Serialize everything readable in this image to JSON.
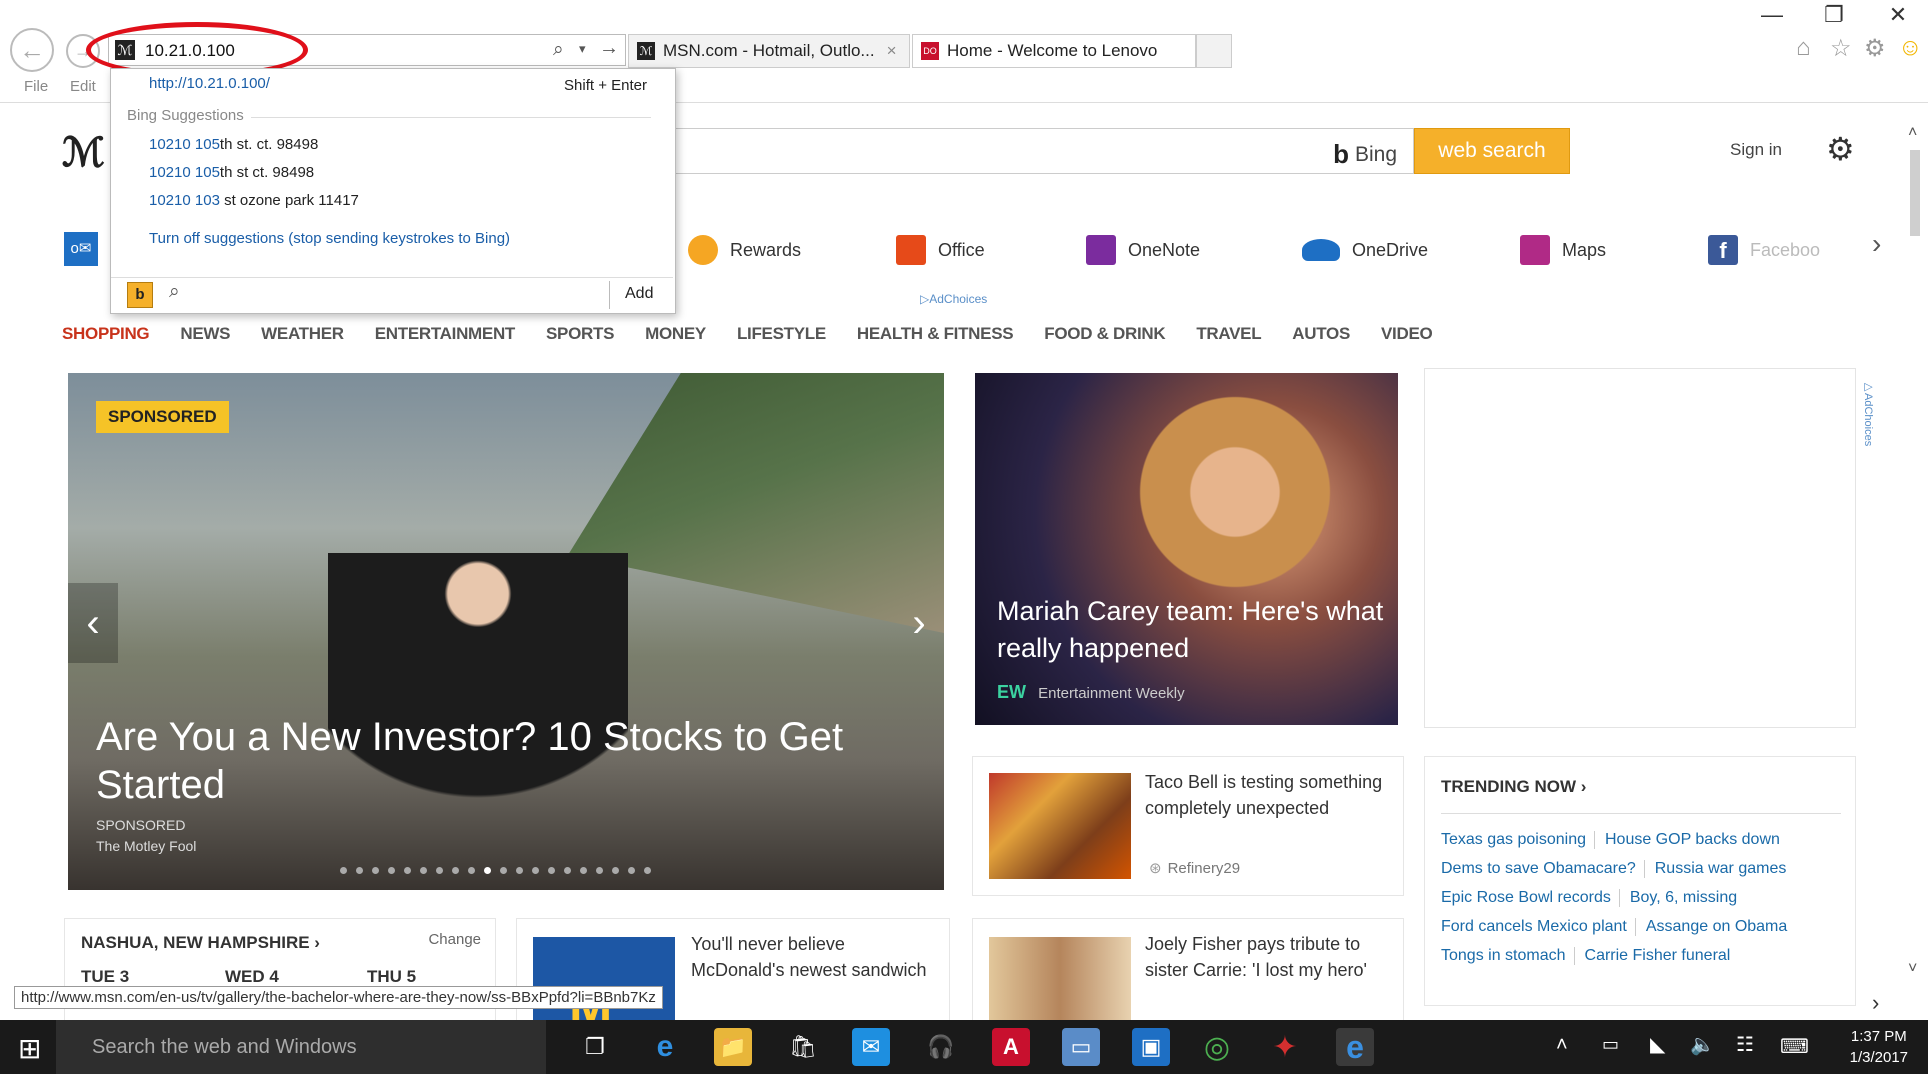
{
  "browser": {
    "address": "10.21.0.100",
    "tabs": [
      {
        "label": "MSN.com - Hotmail, Outlo...",
        "close": "×"
      },
      {
        "label": "Home - Welcome to Lenovo"
      }
    ],
    "menu": [
      "File",
      "Edit"
    ],
    "window_buttons": {
      "minimize": "—",
      "restore": "❐",
      "close": "✕"
    }
  },
  "dropdown": {
    "url_hint": "http://10.21.0.100/",
    "shortcut": "Shift + Enter",
    "section": "Bing Suggestions",
    "suggestions": [
      {
        "match": "10210 105",
        "rest": "th st. ct. 98498"
      },
      {
        "match": "10210 105",
        "rest": "th st ct. 98498"
      },
      {
        "match": "10210 103",
        "rest": " st ozone park 11417"
      }
    ],
    "turn_off": "Turn off suggestions (stop sending keystrokes to Bing)",
    "add": "Add"
  },
  "msn": {
    "bing_label": "Bing",
    "web_search": "web search",
    "sign_in": "Sign in",
    "adchoices": "AdChoices",
    "quicklinks": [
      {
        "label": "Rewards",
        "icon": "rewards-icon",
        "color": "#f5a623"
      },
      {
        "label": "Office",
        "icon": "office-icon",
        "color": "#e64a19"
      },
      {
        "label": "OneNote",
        "icon": "onenote-icon",
        "color": "#7b2c9e"
      },
      {
        "label": "OneDrive",
        "icon": "onedrive-icon",
        "color": "#1e6fc4"
      },
      {
        "label": "Maps",
        "icon": "maps-icon",
        "color": "#b02a86"
      },
      {
        "label": "Faceboo",
        "icon": "facebook-icon",
        "color": "#3b5998"
      }
    ],
    "categories": [
      "SHOPPING",
      "NEWS",
      "WEATHER",
      "ENTERTAINMENT",
      "SPORTS",
      "MONEY",
      "LIFESTYLE",
      "HEALTH & FITNESS",
      "FOOD & DRINK",
      "TRAVEL",
      "AUTOS",
      "VIDEO"
    ],
    "hero": {
      "badge": "SPONSORED",
      "title": "Are You a New Investor? 10 Stocks to Get Started",
      "sponsored": "SPONSORED",
      "source": "The Motley Fool",
      "slide_count": 20,
      "active_slide": 10
    },
    "feature": {
      "title": "Mariah Carey team: Here's what really happened",
      "source_logo": "EW",
      "source": "Entertainment Weekly"
    },
    "cards": [
      {
        "text": "Taco Bell is testing something completely unexpected",
        "source": "Refinery29"
      },
      {
        "text": "You'll never believe McDonald's newest sandwich"
      },
      {
        "text": "Joely Fisher pays tribute to sister Carrie: 'I lost my hero'"
      }
    ],
    "weather": {
      "location": "NASHUA, NEW HAMPSHIRE",
      "change": "Change",
      "days": [
        "TUE 3",
        "WED 4",
        "THU 5"
      ]
    },
    "trending": {
      "title": "TRENDING NOW",
      "rows": [
        [
          "Texas gas poisoning",
          "House GOP backs down"
        ],
        [
          "Dems to save Obamacare?",
          "Russia war games"
        ],
        [
          "Epic Rose Bowl records",
          "Boy, 6, missing"
        ],
        [
          "Ford cancels Mexico plant",
          "Assange on Obama"
        ],
        [
          "Tongs in stomach",
          "Carrie Fisher funeral"
        ]
      ]
    }
  },
  "status_url": "http://www.msn.com/en-us/tv/gallery/the-bachelor-where-are-they-now/ss-BBxPpfd?li=BBnb7Kz",
  "taskbar": {
    "search_placeholder": "Search the web and Windows",
    "time": "1:37 PM",
    "date": "1/3/2017"
  }
}
